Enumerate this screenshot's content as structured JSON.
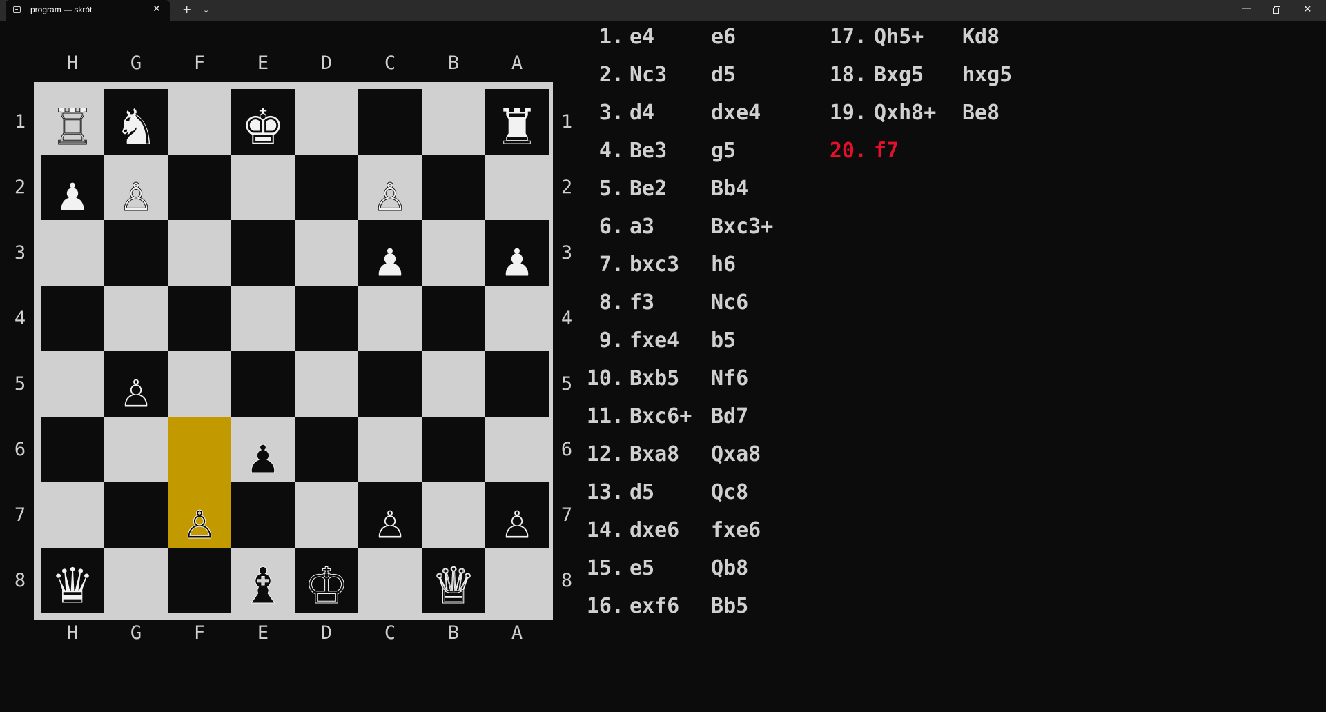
{
  "window": {
    "tab_title": "program — skrót",
    "close_tab": "✕",
    "new_tab": "+",
    "dropdown": "⌄",
    "minimize": "—",
    "close": "✕"
  },
  "board": {
    "files_top": [
      "H",
      "G",
      "F",
      "E",
      "D",
      "C",
      "B",
      "A"
    ],
    "files_bottom": [
      "H",
      "G",
      "F",
      "E",
      "D",
      "C",
      "B",
      "A"
    ],
    "ranks_left": [
      "1",
      "2",
      "3",
      "4",
      "5",
      "6",
      "7",
      "8"
    ],
    "ranks_right": [
      "1",
      "2",
      "3",
      "4",
      "5",
      "6",
      "7",
      "8"
    ],
    "highlight_squares": [
      "F6",
      "F7"
    ],
    "pieces": [
      {
        "square": "H1",
        "glyph": "♖",
        "fill": "white"
      },
      {
        "square": "G1",
        "glyph": "♞",
        "fill": "white"
      },
      {
        "square": "E1",
        "glyph": "♚",
        "fill": "white"
      },
      {
        "square": "A1",
        "glyph": "♜",
        "fill": "white"
      },
      {
        "square": "H2",
        "glyph": "♟",
        "fill": "white"
      },
      {
        "square": "G2",
        "glyph": "♙",
        "fill": "white"
      },
      {
        "square": "C2",
        "glyph": "♙",
        "fill": "white"
      },
      {
        "square": "C3",
        "glyph": "♟",
        "fill": "white"
      },
      {
        "square": "A3",
        "glyph": "♟",
        "fill": "white"
      },
      {
        "square": "G5",
        "glyph": "♙",
        "fill": "white"
      },
      {
        "square": "E6",
        "glyph": "♟",
        "fill": "black"
      },
      {
        "square": "F7",
        "glyph": "♙",
        "fill": "black"
      },
      {
        "square": "C7",
        "glyph": "♙",
        "fill": "white"
      },
      {
        "square": "A7",
        "glyph": "♙",
        "fill": "white"
      },
      {
        "square": "H8",
        "glyph": "♛",
        "fill": "white"
      },
      {
        "square": "E8",
        "glyph": "♝",
        "fill": "black"
      },
      {
        "square": "D8",
        "glyph": "♔",
        "fill": "black"
      },
      {
        "square": "B8",
        "glyph": "♕",
        "fill": "black"
      }
    ]
  },
  "moves": {
    "left": [
      {
        "num": "1.",
        "white": "e4",
        "black": "e6"
      },
      {
        "num": "2.",
        "white": "Nc3",
        "black": "d5"
      },
      {
        "num": "3.",
        "white": "d4",
        "black": "dxe4"
      },
      {
        "num": "4.",
        "white": "Be3",
        "black": "g5"
      },
      {
        "num": "5.",
        "white": "Be2",
        "black": "Bb4"
      },
      {
        "num": "6.",
        "white": "a3",
        "black": "Bxc3+"
      },
      {
        "num": "7.",
        "white": "bxc3",
        "black": "h6"
      },
      {
        "num": "8.",
        "white": "f3",
        "black": "Nc6"
      },
      {
        "num": "9.",
        "white": "fxe4",
        "black": "b5"
      },
      {
        "num": "10.",
        "white": "Bxb5",
        "black": "Nf6"
      },
      {
        "num": "11.",
        "white": "Bxc6+",
        "black": "Bd7"
      },
      {
        "num": "12.",
        "white": "Bxa8",
        "black": "Qxa8"
      },
      {
        "num": "13.",
        "white": "d5",
        "black": "Qc8"
      },
      {
        "num": "14.",
        "white": "dxe6",
        "black": "fxe6"
      },
      {
        "num": "15.",
        "white": "e5",
        "black": "Qb8"
      },
      {
        "num": "16.",
        "white": "exf6",
        "black": "Bb5"
      }
    ],
    "right": [
      {
        "num": "17.",
        "white": "Qh5+",
        "black": "Kd8"
      },
      {
        "num": "18.",
        "white": "Bxg5",
        "black": "hxg5"
      },
      {
        "num": "19.",
        "white": "Qxh8+",
        "black": "Be8"
      },
      {
        "num": "20.",
        "white": "f7",
        "black": ""
      }
    ],
    "current_color": "#e3102a"
  }
}
